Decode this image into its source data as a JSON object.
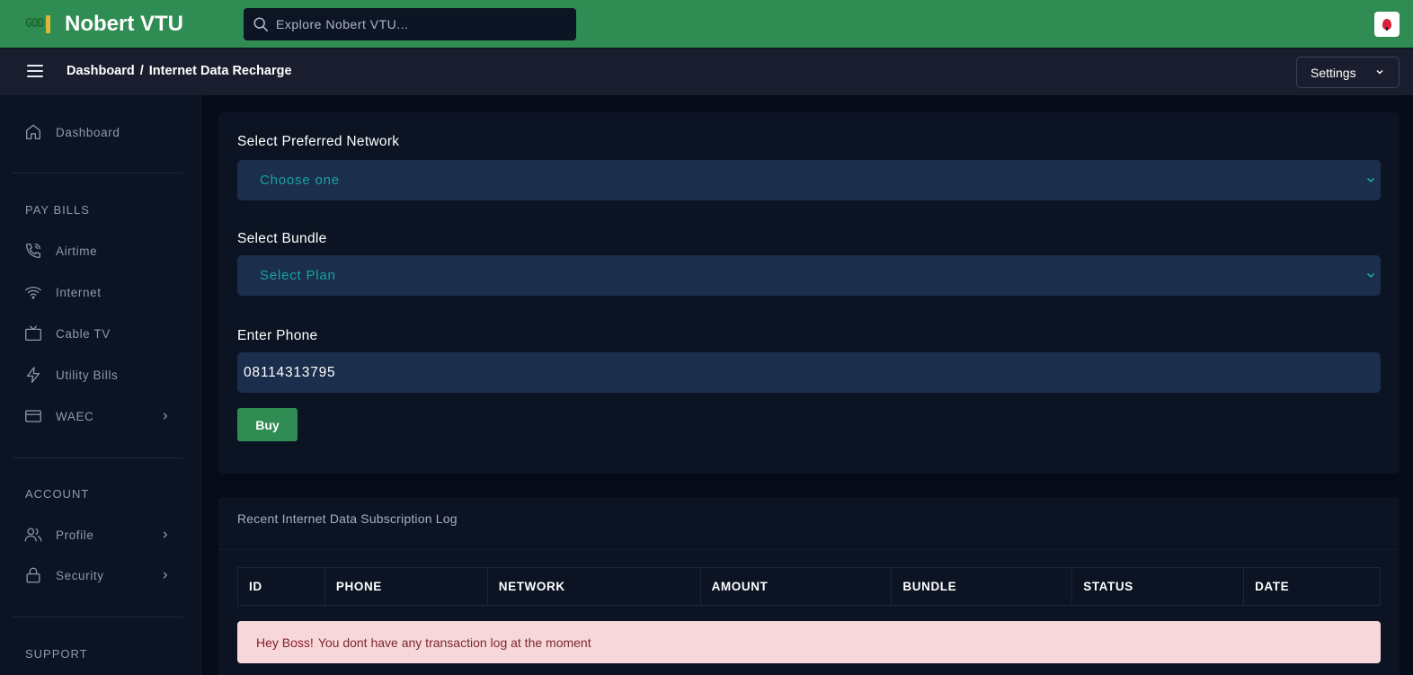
{
  "topbar": {
    "brand_name": "Nobert VTU",
    "search_placeholder": "Explore Nobert VTU..."
  },
  "subbar": {
    "breadcrumb": [
      "Dashboard",
      "/",
      "Internet Data Recharge"
    ],
    "settings_label": "Settings"
  },
  "sidebar": {
    "dashboard": "Dashboard",
    "pay_bills_title": "PAY BILLS",
    "pay_bills": [
      "Airtime",
      "Internet",
      "Cable TV",
      "Utility Bills",
      "WAEC"
    ],
    "account_title": "ACCOUNT",
    "account": [
      "Profile",
      "Security"
    ],
    "support_title": "SUPPORT"
  },
  "form": {
    "network_label": "Select Preferred Network",
    "network_value": "Choose one",
    "bundle_label": "Select Bundle",
    "bundle_value": "Select Plan",
    "phone_label": "Enter Phone",
    "phone_value": "08114313795",
    "buy_label": "Buy"
  },
  "log": {
    "title": "Recent Internet Data Subscription Log",
    "columns": [
      "ID",
      "PHONE",
      "NETWORK",
      "AMOUNT",
      "BUNDLE",
      "STATUS",
      "DATE"
    ],
    "alert_strong": "Hey Boss!",
    "alert_text": "You dont have any transaction log at the moment"
  },
  "colors": {
    "topbar": "#2f8c52",
    "accent_text": "#17a2a2",
    "field_bg": "#1b2e4b",
    "card_bg": "#0c1322",
    "alert_bg": "#f8d7da"
  }
}
